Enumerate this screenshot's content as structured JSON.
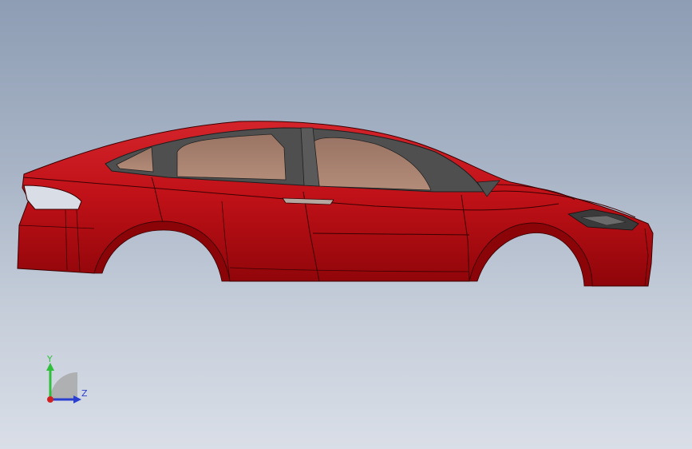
{
  "viewport": {
    "model": {
      "part": "car-body-shell",
      "body_color": "#c1121a",
      "glass_color": "#a8806e",
      "trim_color": "#555555"
    },
    "triad": {
      "y_label": "Y",
      "z_label": "Z",
      "y_color": "#2fbf3a",
      "z_color": "#2a3fd0",
      "x_color": "#d02020"
    }
  }
}
